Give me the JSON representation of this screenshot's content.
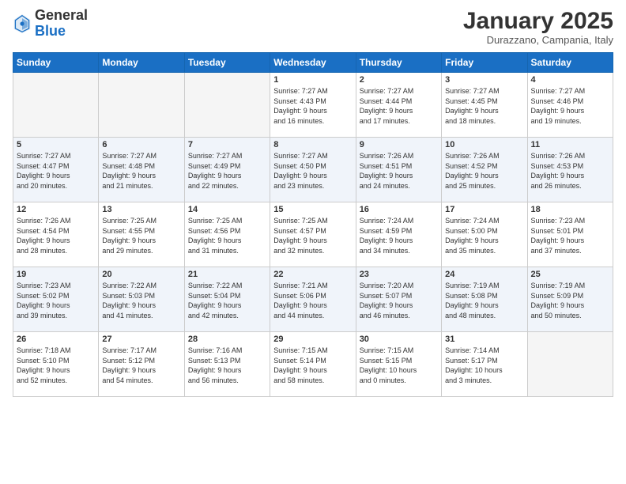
{
  "logo": {
    "general": "General",
    "blue": "Blue"
  },
  "header": {
    "month": "January 2025",
    "location": "Durazzano, Campania, Italy"
  },
  "weekdays": [
    "Sunday",
    "Monday",
    "Tuesday",
    "Wednesday",
    "Thursday",
    "Friday",
    "Saturday"
  ],
  "weeks": [
    [
      {
        "day": "",
        "info": ""
      },
      {
        "day": "",
        "info": ""
      },
      {
        "day": "",
        "info": ""
      },
      {
        "day": "1",
        "info": "Sunrise: 7:27 AM\nSunset: 4:43 PM\nDaylight: 9 hours\nand 16 minutes."
      },
      {
        "day": "2",
        "info": "Sunrise: 7:27 AM\nSunset: 4:44 PM\nDaylight: 9 hours\nand 17 minutes."
      },
      {
        "day": "3",
        "info": "Sunrise: 7:27 AM\nSunset: 4:45 PM\nDaylight: 9 hours\nand 18 minutes."
      },
      {
        "day": "4",
        "info": "Sunrise: 7:27 AM\nSunset: 4:46 PM\nDaylight: 9 hours\nand 19 minutes."
      }
    ],
    [
      {
        "day": "5",
        "info": "Sunrise: 7:27 AM\nSunset: 4:47 PM\nDaylight: 9 hours\nand 20 minutes."
      },
      {
        "day": "6",
        "info": "Sunrise: 7:27 AM\nSunset: 4:48 PM\nDaylight: 9 hours\nand 21 minutes."
      },
      {
        "day": "7",
        "info": "Sunrise: 7:27 AM\nSunset: 4:49 PM\nDaylight: 9 hours\nand 22 minutes."
      },
      {
        "day": "8",
        "info": "Sunrise: 7:27 AM\nSunset: 4:50 PM\nDaylight: 9 hours\nand 23 minutes."
      },
      {
        "day": "9",
        "info": "Sunrise: 7:26 AM\nSunset: 4:51 PM\nDaylight: 9 hours\nand 24 minutes."
      },
      {
        "day": "10",
        "info": "Sunrise: 7:26 AM\nSunset: 4:52 PM\nDaylight: 9 hours\nand 25 minutes."
      },
      {
        "day": "11",
        "info": "Sunrise: 7:26 AM\nSunset: 4:53 PM\nDaylight: 9 hours\nand 26 minutes."
      }
    ],
    [
      {
        "day": "12",
        "info": "Sunrise: 7:26 AM\nSunset: 4:54 PM\nDaylight: 9 hours\nand 28 minutes."
      },
      {
        "day": "13",
        "info": "Sunrise: 7:25 AM\nSunset: 4:55 PM\nDaylight: 9 hours\nand 29 minutes."
      },
      {
        "day": "14",
        "info": "Sunrise: 7:25 AM\nSunset: 4:56 PM\nDaylight: 9 hours\nand 31 minutes."
      },
      {
        "day": "15",
        "info": "Sunrise: 7:25 AM\nSunset: 4:57 PM\nDaylight: 9 hours\nand 32 minutes."
      },
      {
        "day": "16",
        "info": "Sunrise: 7:24 AM\nSunset: 4:59 PM\nDaylight: 9 hours\nand 34 minutes."
      },
      {
        "day": "17",
        "info": "Sunrise: 7:24 AM\nSunset: 5:00 PM\nDaylight: 9 hours\nand 35 minutes."
      },
      {
        "day": "18",
        "info": "Sunrise: 7:23 AM\nSunset: 5:01 PM\nDaylight: 9 hours\nand 37 minutes."
      }
    ],
    [
      {
        "day": "19",
        "info": "Sunrise: 7:23 AM\nSunset: 5:02 PM\nDaylight: 9 hours\nand 39 minutes."
      },
      {
        "day": "20",
        "info": "Sunrise: 7:22 AM\nSunset: 5:03 PM\nDaylight: 9 hours\nand 41 minutes."
      },
      {
        "day": "21",
        "info": "Sunrise: 7:22 AM\nSunset: 5:04 PM\nDaylight: 9 hours\nand 42 minutes."
      },
      {
        "day": "22",
        "info": "Sunrise: 7:21 AM\nSunset: 5:06 PM\nDaylight: 9 hours\nand 44 minutes."
      },
      {
        "day": "23",
        "info": "Sunrise: 7:20 AM\nSunset: 5:07 PM\nDaylight: 9 hours\nand 46 minutes."
      },
      {
        "day": "24",
        "info": "Sunrise: 7:19 AM\nSunset: 5:08 PM\nDaylight: 9 hours\nand 48 minutes."
      },
      {
        "day": "25",
        "info": "Sunrise: 7:19 AM\nSunset: 5:09 PM\nDaylight: 9 hours\nand 50 minutes."
      }
    ],
    [
      {
        "day": "26",
        "info": "Sunrise: 7:18 AM\nSunset: 5:10 PM\nDaylight: 9 hours\nand 52 minutes."
      },
      {
        "day": "27",
        "info": "Sunrise: 7:17 AM\nSunset: 5:12 PM\nDaylight: 9 hours\nand 54 minutes."
      },
      {
        "day": "28",
        "info": "Sunrise: 7:16 AM\nSunset: 5:13 PM\nDaylight: 9 hours\nand 56 minutes."
      },
      {
        "day": "29",
        "info": "Sunrise: 7:15 AM\nSunset: 5:14 PM\nDaylight: 9 hours\nand 58 minutes."
      },
      {
        "day": "30",
        "info": "Sunrise: 7:15 AM\nSunset: 5:15 PM\nDaylight: 10 hours\nand 0 minutes."
      },
      {
        "day": "31",
        "info": "Sunrise: 7:14 AM\nSunset: 5:17 PM\nDaylight: 10 hours\nand 3 minutes."
      },
      {
        "day": "",
        "info": ""
      }
    ]
  ]
}
